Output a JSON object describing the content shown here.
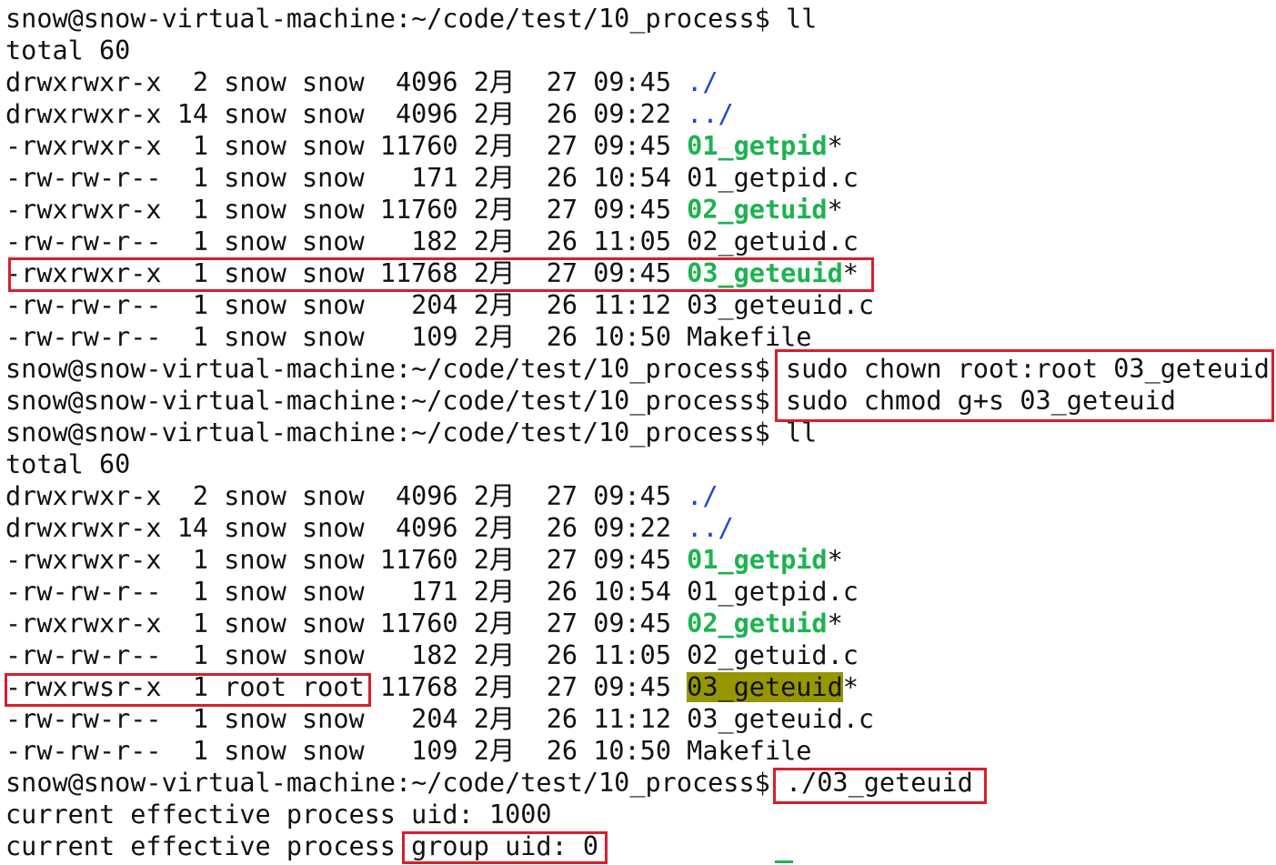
{
  "prompt": "snow@snow-virtual-machine:~/code/test/10_process$ ",
  "colors": {
    "directory": "#1f43d8",
    "executable": "#1cb34f",
    "setgid_background": "#969600",
    "highlight_box": "#d81e2c"
  },
  "lines": [
    {
      "kind": "prompt",
      "cmd": "ll"
    },
    {
      "kind": "text",
      "text": "total 60"
    },
    {
      "kind": "entry",
      "meta": "drwxrwxr-x  2 snow snow  4096 2月  27 09:45 ",
      "name": "./",
      "name_type": "directory",
      "suffix": ""
    },
    {
      "kind": "entry",
      "meta": "drwxrwxr-x 14 snow snow  4096 2月  26 09:22 ",
      "name": "../",
      "name_type": "directory",
      "suffix": ""
    },
    {
      "kind": "entry",
      "meta": "-rwxrwxr-x  1 snow snow 11760 2月  27 09:45 ",
      "name": "01_getpid",
      "name_type": "executable",
      "suffix": "*"
    },
    {
      "kind": "entry",
      "meta": "-rw-rw-r--  1 snow snow   171 2月  26 10:54 ",
      "name": "01_getpid.c",
      "name_type": "plain",
      "suffix": ""
    },
    {
      "kind": "entry",
      "meta": "-rwxrwxr-x  1 snow snow 11760 2月  27 09:45 ",
      "name": "02_getuid",
      "name_type": "executable",
      "suffix": "*"
    },
    {
      "kind": "entry",
      "meta": "-rw-rw-r--  1 snow snow   182 2月  26 11:05 ",
      "name": "02_getuid.c",
      "name_type": "plain",
      "suffix": ""
    },
    {
      "kind": "entry",
      "meta": "-rwxrwxr-x  1 snow snow 11768 2月  27 09:45 ",
      "name": "03_geteuid",
      "name_type": "executable",
      "suffix": "*"
    },
    {
      "kind": "entry",
      "meta": "-rw-rw-r--  1 snow snow   204 2月  26 11:12 ",
      "name": "03_geteuid.c",
      "name_type": "plain",
      "suffix": ""
    },
    {
      "kind": "entry",
      "meta": "-rw-rw-r--  1 snow snow   109 2月  26 10:50 ",
      "name": "Makefile",
      "name_type": "plain",
      "suffix": ""
    },
    {
      "kind": "prompt",
      "cmd": "sudo chown root:root 03_geteuid"
    },
    {
      "kind": "prompt",
      "cmd": "sudo chmod g+s 03_geteuid"
    },
    {
      "kind": "prompt",
      "cmd": "ll"
    },
    {
      "kind": "text",
      "text": "total 60"
    },
    {
      "kind": "entry",
      "meta": "drwxrwxr-x  2 snow snow  4096 2月  27 09:45 ",
      "name": "./",
      "name_type": "directory",
      "suffix": ""
    },
    {
      "kind": "entry",
      "meta": "drwxrwxr-x 14 snow snow  4096 2月  26 09:22 ",
      "name": "../",
      "name_type": "directory",
      "suffix": ""
    },
    {
      "kind": "entry",
      "meta": "-rwxrwxr-x  1 snow snow 11760 2月  27 09:45 ",
      "name": "01_getpid",
      "name_type": "executable",
      "suffix": "*"
    },
    {
      "kind": "entry",
      "meta": "-rw-rw-r--  1 snow snow   171 2月  26 10:54 ",
      "name": "01_getpid.c",
      "name_type": "plain",
      "suffix": ""
    },
    {
      "kind": "entry",
      "meta": "-rwxrwxr-x  1 snow snow 11760 2月  27 09:45 ",
      "name": "02_getuid",
      "name_type": "executable",
      "suffix": "*"
    },
    {
      "kind": "entry",
      "meta": "-rw-rw-r--  1 snow snow   182 2月  26 11:05 ",
      "name": "02_getuid.c",
      "name_type": "plain",
      "suffix": ""
    },
    {
      "kind": "entry",
      "meta": "-rwxrwsr-x  1 root root 11768 2月  27 09:45 ",
      "name": "03_geteuid",
      "name_type": "setgid",
      "suffix": "*"
    },
    {
      "kind": "entry",
      "meta": "-rw-rw-r--  1 snow snow   204 2月  26 11:12 ",
      "name": "03_geteuid.c",
      "name_type": "plain",
      "suffix": ""
    },
    {
      "kind": "entry",
      "meta": "-rw-rw-r--  1 snow snow   109 2月  26 10:50 ",
      "name": "Makefile",
      "name_type": "plain",
      "suffix": ""
    },
    {
      "kind": "prompt",
      "cmd": "./03_geteuid"
    },
    {
      "kind": "text",
      "text": "current effective process uid: 1000"
    },
    {
      "kind": "text",
      "text": "current effective process group uid: 0"
    }
  ]
}
